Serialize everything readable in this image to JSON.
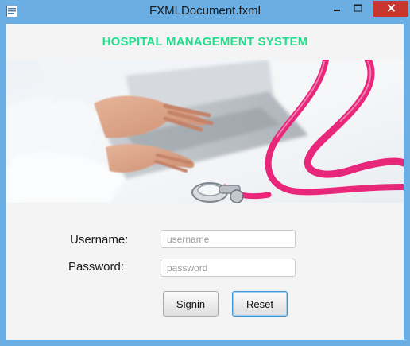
{
  "window": {
    "title": "FXMLDocument.fxml"
  },
  "header": {
    "title": "HOSPITAL MANAGEMENT SYSTEM"
  },
  "banner": {
    "image": "doctor-typing-laptop-with-stethoscope"
  },
  "form": {
    "username_label": "Username:",
    "username_placeholder": "username",
    "username_value": "",
    "password_label": "Password:",
    "password_placeholder": "password",
    "password_value": "",
    "signin_label": "Signin",
    "reset_label": "Reset"
  },
  "colors": {
    "title_accent": "#22dd8c",
    "window_frame": "#6aaee4",
    "close_button": "#c7372f",
    "stethoscope": "#e8267a"
  }
}
